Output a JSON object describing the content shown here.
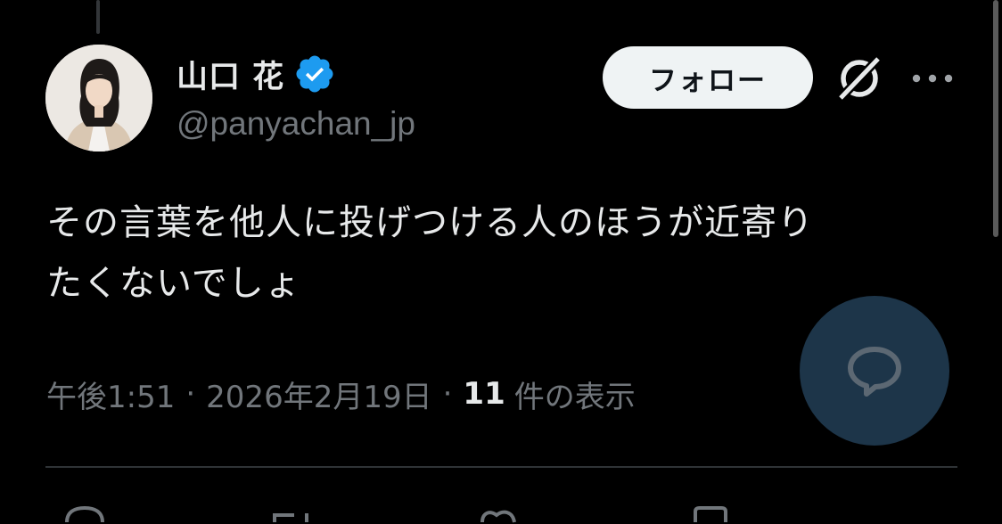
{
  "author": {
    "display_name": "山口 花",
    "handle": "@panyachan_jp",
    "verified": true
  },
  "follow_button_label": "フォロー",
  "tweet": {
    "text_line1": "その言葉を他人に投げつける人のほうが近寄り",
    "text_line2": "たくないでしょ",
    "time": "午後1:51",
    "separator": "·",
    "date": "2026年2月19日",
    "views_count": "11",
    "views_label": "件の表示"
  },
  "icons": {
    "verified": "verified-badge-icon",
    "grok": "grok-icon",
    "more": "more-options-icon",
    "reply": "reply-icon"
  },
  "colors": {
    "background": "#000000",
    "primary_text": "#e7e9ea",
    "secondary_text": "#71767b",
    "verified_blue": "#1d9bf0",
    "follow_button_bg": "#eff3f4",
    "reply_fab_bg": "#1d3549",
    "divider": "#2f3336"
  }
}
